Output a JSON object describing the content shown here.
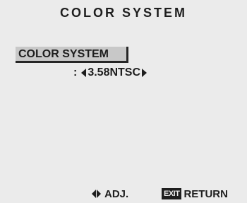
{
  "menu": {
    "title": "COLOR SYSTEM",
    "selected_item": {
      "label": "COLOR SYSTEM",
      "separator": ":",
      "value": "3.58NTSC"
    }
  },
  "footer": {
    "adjust": {
      "icon": "left-right-arrows-icon",
      "label": "ADJ."
    },
    "return": {
      "badge": "EXIT",
      "label": "RETURN"
    }
  },
  "colors": {
    "background": "#ebebeb",
    "text": "#1e1e1e",
    "highlight": "#c8c8c8"
  }
}
